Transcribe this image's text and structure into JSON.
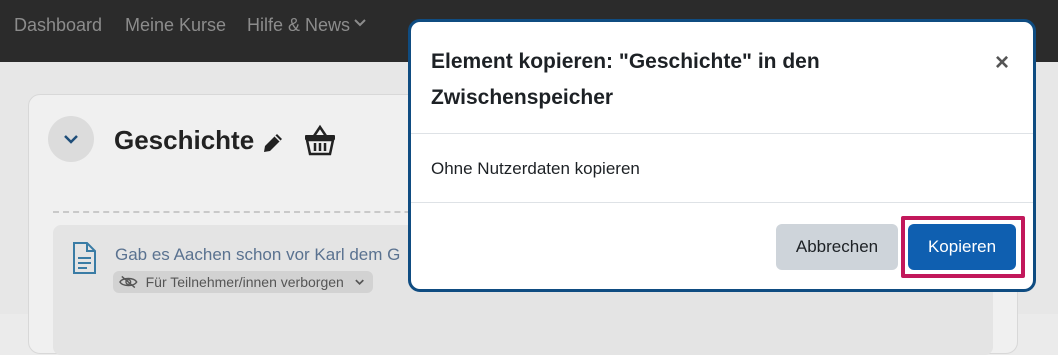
{
  "navbar": {
    "items": [
      {
        "label": "Dashboard"
      },
      {
        "label": "Meine Kurse"
      },
      {
        "label": "Hilfe & News"
      }
    ]
  },
  "section": {
    "title": "Geschichte",
    "activity": {
      "title": "Gab es Aachen schon vor Karl dem G",
      "badge": "Für Teilnehmer/innen verborgen"
    }
  },
  "modal": {
    "title": "Element kopieren: \"Geschichte\" in den Zwischenspeicher",
    "close_label": "×",
    "body": "Ohne Nutzerdaten kopieren",
    "cancel_label": "Abbrechen",
    "confirm_label": "Kopieren"
  },
  "colors": {
    "navbar_bg": "#2b2b2b",
    "primary": "#0f5fb0",
    "modal_border": "#0f4c81",
    "focus_ring": "#c2185b"
  }
}
